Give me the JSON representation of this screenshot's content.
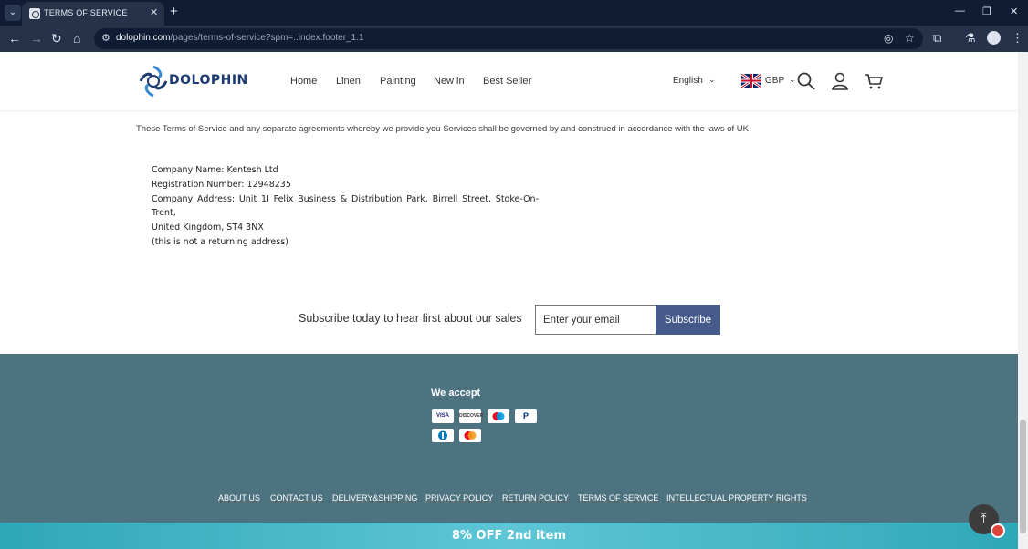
{
  "browser": {
    "tab_title": "TERMS OF SERVICE",
    "url_domain": "dolophin.com",
    "url_path": "/pages/terms-of-service?spm=..index.footer_1.1"
  },
  "header": {
    "logo_text": "DOLOPHIN",
    "nav": [
      "Home",
      "Linen",
      "Painting",
      "New in",
      "Best Seller"
    ],
    "language": "English",
    "currency": "GBP"
  },
  "content": {
    "terms_line": "These Terms of Service and any separate agreements whereby we provide you Services shall be governed by and construed in accordance with the laws of UK",
    "company_name": "Company Name: Kentesh Ltd",
    "registration": "Registration Number: 12948235",
    "address_line1": "Company Address: Unit 1I Felix Business & Distribution Park, Birrell Street, Stoke-On-Trent,",
    "address_line2": "United Kingdom, ST4 3NX",
    "note": "(this is not a returning address)"
  },
  "subscribe": {
    "text": "Subscribe today to hear first about our sales",
    "placeholder": "Enter your email",
    "button": "Subscribe"
  },
  "footer": {
    "accept_title": "We accept",
    "payment_icons": [
      "visa-icon",
      "discover-icon",
      "maestro-icon",
      "paypal-icon",
      "diners-icon",
      "mastercard-icon"
    ],
    "payment_labels": {
      "visa": "VISA",
      "discover": "DISCOVER"
    },
    "links": [
      "ABOUT US",
      "CONTACT US",
      "DELIVERY&SHIPPING",
      "PRIVACY POLICY",
      "RETURN POLICY",
      "TERMS OF SERVICE",
      "INTELLECTUAL PROPERTY RIGHTS"
    ],
    "bg_color": "#4d7280"
  },
  "promo": {
    "text": "8% OFF 2nd item"
  }
}
